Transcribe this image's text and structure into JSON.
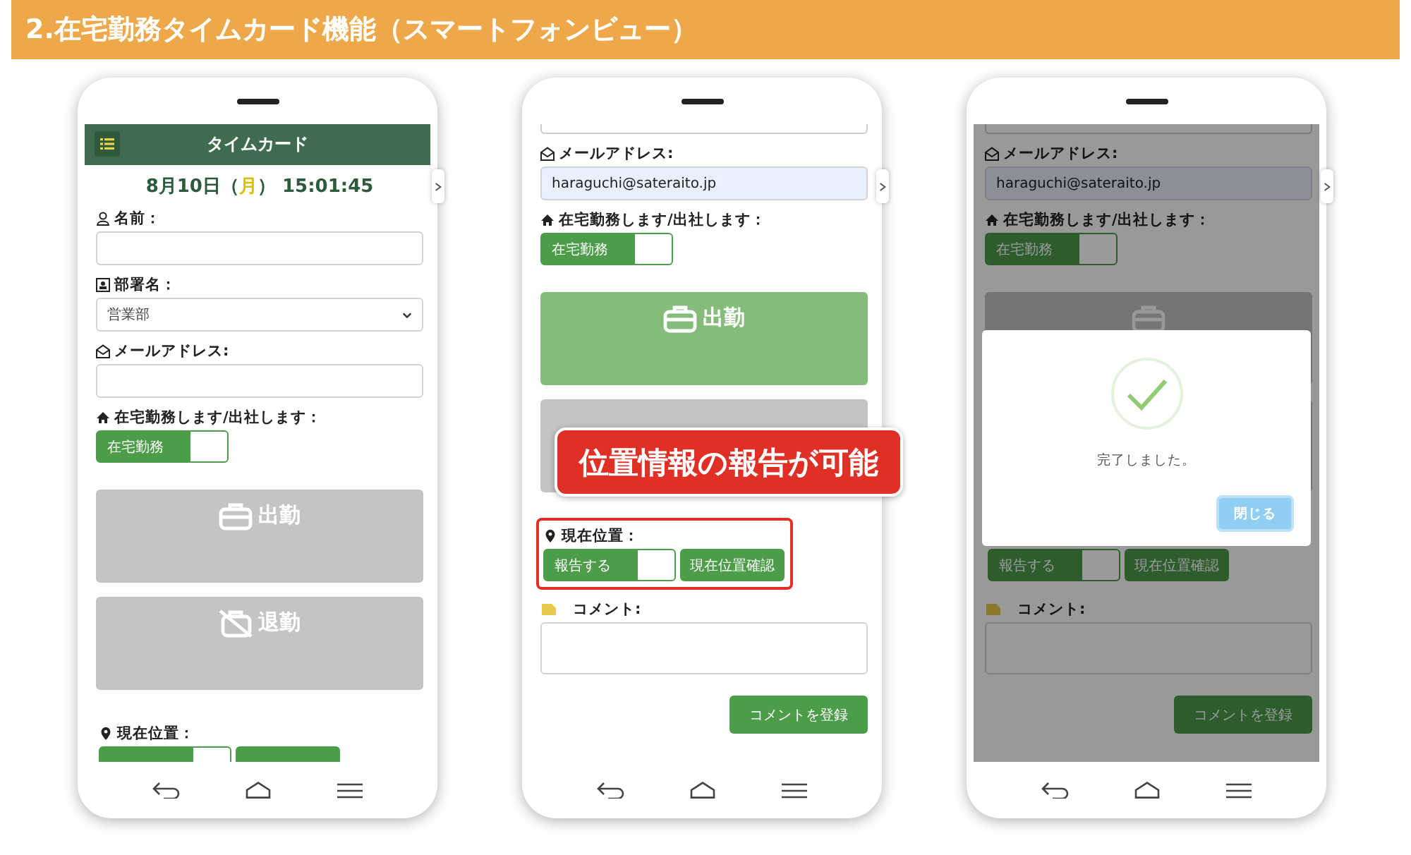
{
  "banner": {
    "title": "2.在宅勤務タイムカード機能（スマートフォンビュー）"
  },
  "phones": [
    {
      "scrolled": false,
      "overlay": false,
      "items": [
        {
          "kind": "header",
          "title": "タイムカード"
        },
        {
          "kind": "clock",
          "date": "8月10日",
          "open": "（",
          "weekday": "月",
          "close": "）",
          "time": "15:01:45"
        },
        {
          "kind": "name_field",
          "label": "名前："
        },
        {
          "kind": "select",
          "label": "部署名：",
          "value": "営業部"
        },
        {
          "kind": "email_field",
          "label": "メールアドレス:"
        },
        {
          "kind": "toggle",
          "label": "在宅勤務します/出社します：",
          "toggle_label": "在宅勤務",
          "on": true
        },
        {
          "kind": "clock_in",
          "label": "出勤",
          "enabled": false
        },
        {
          "kind": "clock_out",
          "label": "退勤",
          "enabled": false
        },
        {
          "kind": "location",
          "label": "現在位置：",
          "on": true,
          "highlighted": false
        }
      ]
    },
    {
      "scrolled": true,
      "overlay": false,
      "callout": "位置情報の報告が可能",
      "items": [
        {
          "kind": "email_field",
          "label": "メールアドレス:",
          "value": "haraguchi@sateraito.jp",
          "autofilled": true
        },
        {
          "kind": "toggle",
          "label": "在宅勤務します/出社します：",
          "toggle_label": "在宅勤務",
          "on": true
        },
        {
          "kind": "clock_in",
          "label": "出勤",
          "enabled": true
        },
        {
          "kind": "covered_button"
        },
        {
          "kind": "location",
          "label": "現在位置：",
          "toggle_label": "報告する",
          "on": true,
          "button": "現在位置確認",
          "highlighted": true
        },
        {
          "kind": "textarea",
          "label": "コメント:"
        },
        {
          "kind": "submit",
          "label": "コメントを登録"
        }
      ]
    },
    {
      "scrolled": true,
      "overlay": true,
      "modal": {
        "message": "完了しました。",
        "button": "閉じる"
      },
      "items": [
        {
          "kind": "email_field",
          "label": "メールアドレス:",
          "value": "haraguchi@sateraito.jp",
          "autofilled": true
        },
        {
          "kind": "toggle",
          "label": "在宅勤務します/出社します：",
          "toggle_label": "在宅勤務",
          "on": true
        },
        {
          "kind": "clock_in",
          "enabled": false
        },
        {
          "kind": "covered_button"
        },
        {
          "kind": "location",
          "toggle_label": "報告する",
          "on": true,
          "button": "現在位置確認",
          "highlighted": false
        },
        {
          "kind": "textarea",
          "label": "コメント:"
        },
        {
          "kind": "submit",
          "label": "コメントを登録"
        }
      ]
    }
  ]
}
